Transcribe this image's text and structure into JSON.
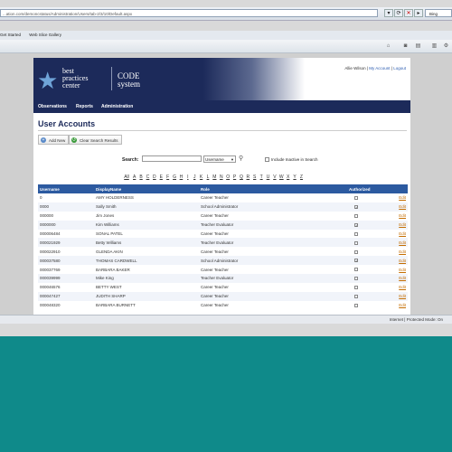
{
  "browser": {
    "url": "...ation.com/demoncstatus/Administration/Users/tab-2/3/10/Default.aspx",
    "search_engine": "Bing",
    "favorites": [
      "Get Started",
      "Web Slice Gallery"
    ]
  },
  "site": {
    "logo_line1": "best",
    "logo_line2": "practices",
    "logo_line3": "center",
    "code_line1": "CODE",
    "code_line2": "system",
    "user_name": "Allie Wilson",
    "my_account": "My Account",
    "logout": "Logout"
  },
  "nav": [
    "Observations",
    "Reports",
    "Administration"
  ],
  "page": {
    "title": "User Accounts",
    "add_new": "Add New",
    "clear_search": "Clear Search Results",
    "search_label": "Search:",
    "search_field_selected": "Username",
    "include_inactive": "Include Inactive in Search"
  },
  "alphabet": [
    "All",
    "A",
    "B",
    "C",
    "D",
    "E",
    "F",
    "G",
    "H",
    "I",
    "J",
    "K",
    "L",
    "M",
    "N",
    "O",
    "P",
    "Q",
    "R",
    "S",
    "T",
    "U",
    "V",
    "W",
    "X",
    "Y",
    "Z"
  ],
  "table": {
    "headers": [
      "Username",
      "DisplayName",
      "Role",
      "Authorized",
      ""
    ],
    "rows": [
      {
        "username": "0",
        "display": "AMY HOLDERNESS",
        "role": "Career Teacher",
        "authorized": false,
        "action": "Edit"
      },
      {
        "username": "0000",
        "display": "Sally Smith",
        "role": "School Administrator",
        "authorized": true,
        "action": "Edit"
      },
      {
        "username": "000000",
        "display": "Jim Jones",
        "role": "Career Teacher",
        "authorized": false,
        "action": "Edit"
      },
      {
        "username": "0000000",
        "display": "Kim Williams",
        "role": "Teacher Evaluator",
        "authorized": true,
        "action": "Edit"
      },
      {
        "username": "000006484",
        "display": "SONAL PATEL",
        "role": "Career Teacher",
        "authorized": false,
        "action": "Edit"
      },
      {
        "username": "000021929",
        "display": "Betty Williams",
        "role": "Teacher Evaluator",
        "authorized": false,
        "action": "Edit"
      },
      {
        "username": "000022910",
        "display": "GLENDA AKIN",
        "role": "Career Teacher",
        "authorized": false,
        "action": "Edit"
      },
      {
        "username": "000037580",
        "display": "THOMAS CARDWELL",
        "role": "School Administrator",
        "authorized": true,
        "action": "Edit"
      },
      {
        "username": "000037769",
        "display": "BARBARA BAKER",
        "role": "Career Teacher",
        "authorized": false,
        "action": "Edit"
      },
      {
        "username": "000039999",
        "display": "Mike King",
        "role": "Teacher Evaluator",
        "authorized": false,
        "action": "Edit"
      },
      {
        "username": "000046576",
        "display": "BETTY WEST",
        "role": "Career Teacher",
        "authorized": false,
        "action": "Edit"
      },
      {
        "username": "000047427",
        "display": "JUDITH SHARP",
        "role": "Career Teacher",
        "authorized": false,
        "action": "Edit"
      },
      {
        "username": "000048320",
        "display": "BARBARA BURNETT",
        "role": "Career Teacher",
        "authorized": false,
        "action": "Edit"
      }
    ]
  },
  "status": {
    "zone": "Internet | Protected Mode: On"
  },
  "colors": {
    "brand_navy": "#1c2a5a",
    "table_header": "#2c5aa0",
    "desktop": "#0f8a8a"
  }
}
